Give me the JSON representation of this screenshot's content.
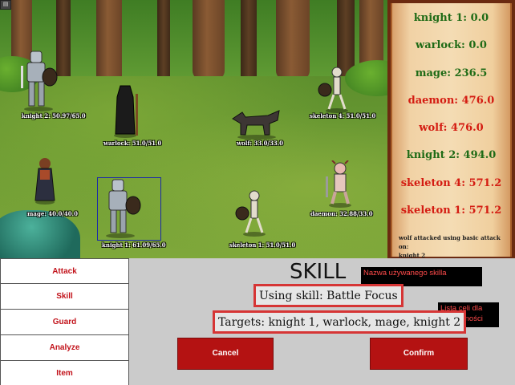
{
  "battle": {
    "units": [
      {
        "key": "knight2",
        "label": "knight 2: 50.97/65.0",
        "side": "ally"
      },
      {
        "key": "warlock",
        "label": "warlock: 51.0/51.0",
        "side": "ally"
      },
      {
        "key": "mage",
        "label": "mage: 40.0/40.0",
        "side": "ally"
      },
      {
        "key": "knight1",
        "label": "knight 1: 61.09/65.0",
        "side": "ally",
        "selected": true
      },
      {
        "key": "wolf",
        "label": "wolf: 33.0/33.0",
        "side": "enemy"
      },
      {
        "key": "skeleton4",
        "label": "skeleton 4: 51.0/51.0",
        "side": "enemy"
      },
      {
        "key": "daemon",
        "label": "daemon: 32.88/33.0",
        "side": "enemy"
      },
      {
        "key": "skeleton1",
        "label": "skeleton 1: 51.0/51.0",
        "side": "enemy"
      }
    ]
  },
  "turn_order": [
    {
      "text": "knight 1: 0.0",
      "side": "ally"
    },
    {
      "text": "warlock: 0.0",
      "side": "ally"
    },
    {
      "text": "mage: 236.5",
      "side": "ally"
    },
    {
      "text": "daemon: 476.0",
      "side": "enemy"
    },
    {
      "text": "wolf: 476.0",
      "side": "enemy"
    },
    {
      "text": "knight 2: 494.0",
      "side": "ally"
    },
    {
      "text": "skeleton 4: 571.2",
      "side": "enemy"
    },
    {
      "text": "skeleton 1: 571.2",
      "side": "enemy"
    }
  ],
  "log": {
    "line1": "wolf attacked using basic attack on:",
    "line2": "knight 2"
  },
  "menu": {
    "attack": "Attack",
    "skill": "Skill",
    "guard": "Guard",
    "analyze": "Analyze",
    "item": "Item"
  },
  "skill_panel": {
    "title": "SKILL",
    "using": "Using skill: Battle Focus",
    "targets": "Targets: knight 1, warlock, mage, knight 2",
    "note_skill": "Nazwa używanego skilla",
    "note_targets": "Lista celi dla umiejętności",
    "cancel": "Cancel",
    "confirm": "Confirm"
  },
  "colors": {
    "ally": "#1f6b16",
    "enemy": "#d41c12",
    "button": "#b41212",
    "highlight_border": "#d63535"
  }
}
